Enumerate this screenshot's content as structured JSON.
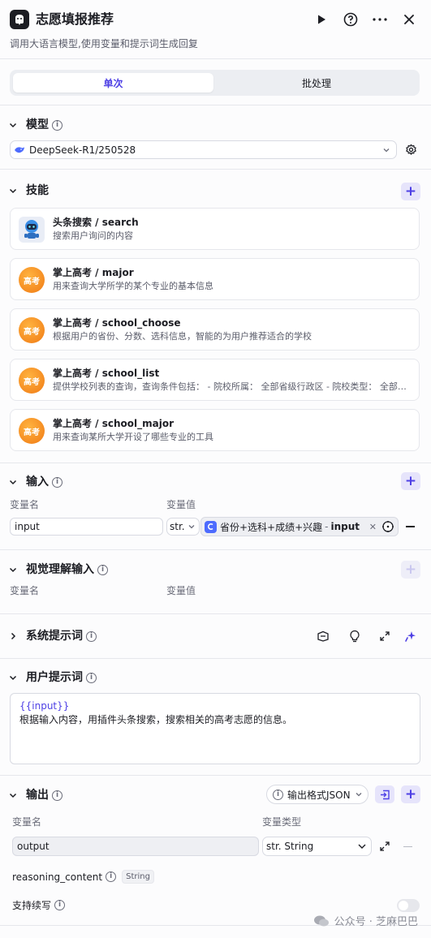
{
  "header": {
    "title": "志愿填报推荐",
    "subtitle": "调用大语言模型,使用变量和提示词生成回复"
  },
  "tabs": [
    {
      "label": "单次",
      "active": true
    },
    {
      "label": "批处理",
      "active": false
    }
  ],
  "model": {
    "section_title": "模型",
    "selected": "DeepSeek-R1/250528"
  },
  "skills": {
    "section_title": "技能",
    "items": [
      {
        "name": "头条搜索 / search",
        "desc": "搜索用户询问的内容",
        "icon": "robot-icon"
      },
      {
        "name": "掌上高考 / major",
        "desc": "用来查询大学所学的某个专业的基本信息",
        "icon": "gaokao-icon"
      },
      {
        "name": "掌上高考 / school_choose",
        "desc": "根据用户的省份、分数、选科信息，智能的为用户推荐适合的学校",
        "icon": "gaokao-icon"
      },
      {
        "name": "掌上高考 / school_list",
        "desc": "提供学校列表的查询，查询条件包括： - 院校所属： 全部省级行政区 - 院校类型： 全部、综合类、理工类...",
        "icon": "gaokao-icon"
      },
      {
        "name": "掌上高考 / school_major",
        "desc": "用来查询某所大学开设了哪些专业的工具",
        "icon": "gaokao-icon"
      }
    ],
    "gaokao_logo_text": "高考"
  },
  "input": {
    "section_title": "输入",
    "col_name": "变量名",
    "col_value": "变量值",
    "var_name": "input",
    "type_short": "str.",
    "ref_path": "省份+选科+成绩+兴趣",
    "ref_sep": "-",
    "ref_var": "input"
  },
  "visual_input": {
    "section_title": "视觉理解输入",
    "col_name": "变量名",
    "col_value": "变量值"
  },
  "system_prompt": {
    "section_title": "系统提示词"
  },
  "user_prompt": {
    "section_title": "用户提示词",
    "line1": "{{input}}",
    "line2": "根据输入内容，用插件头条搜索，搜索相关的高考志愿的信息。"
  },
  "output": {
    "section_title": "输出",
    "format_label": "输出格式JSON",
    "col_name": "变量名",
    "col_type": "变量类型",
    "var_name": "output",
    "var_type": "str. String",
    "reasoning_label": "reasoning_content",
    "reasoning_tag": "String",
    "continue_label": "支持续写"
  },
  "watermark": {
    "text": "公众号 · 芝麻巴巴"
  },
  "colors": {
    "accent": "#4e40e5",
    "border": "#d8dae2",
    "muted": "#6b6d7a"
  }
}
